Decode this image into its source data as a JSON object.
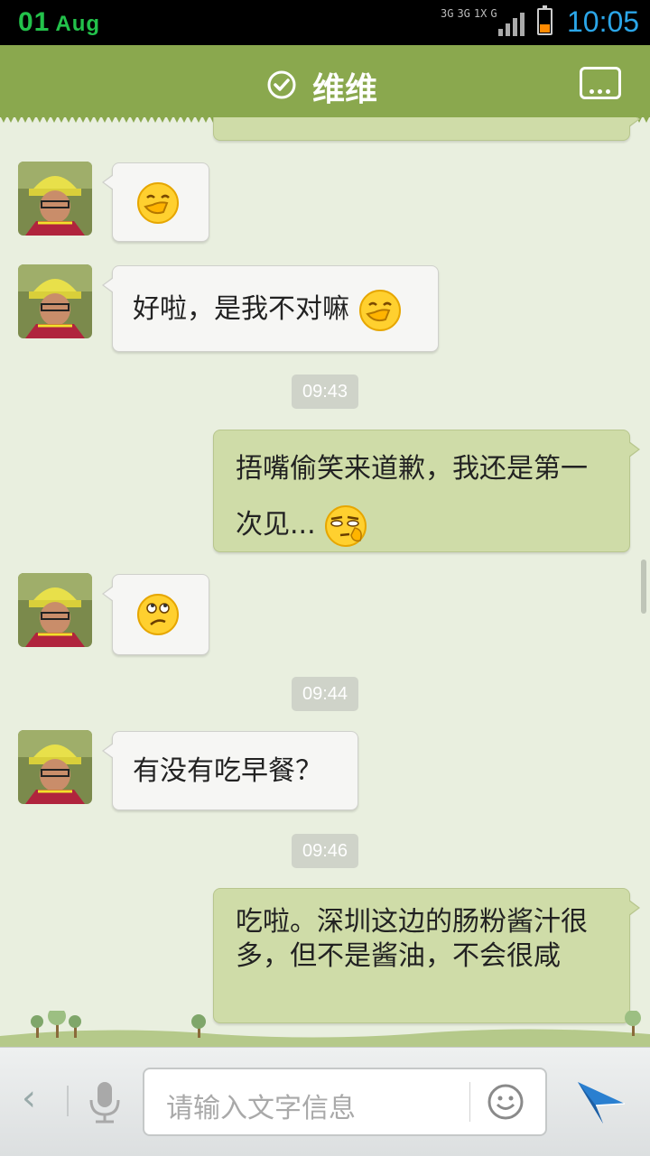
{
  "status_bar": {
    "date_day": "01",
    "date_month": "Aug",
    "network_labels": [
      "3G",
      "3G",
      "1X",
      "G"
    ],
    "time": "10:05"
  },
  "header": {
    "title": "维维",
    "verified_icon": "check-circle-icon",
    "menu_icon": "chat-menu-icon",
    "bg_color": "#8aa84e"
  },
  "messages": [
    {
      "side": "in",
      "text": "",
      "emoji": "giggle-emoji"
    },
    {
      "side": "in",
      "text": "好啦，是我不对嘛",
      "emoji": "giggle-emoji"
    },
    {
      "type": "time",
      "text": "09:43"
    },
    {
      "side": "out",
      "text": "捂嘴偷笑来道歉，我还是第一次见...",
      "emoji": "doubt-emoji"
    },
    {
      "side": "in",
      "text": "",
      "emoji": "confused-emoji"
    },
    {
      "type": "time",
      "text": "09:44"
    },
    {
      "side": "in",
      "text": "有没有吃早餐？"
    },
    {
      "type": "time",
      "text": "09:46"
    },
    {
      "side": "out",
      "text": "吃啦。深圳这边的肠粉酱汁很多，但不是酱油，不会很咸"
    }
  ],
  "input_bar": {
    "placeholder": "请输入文字信息",
    "back_icon": "chevron-left-icon",
    "mic_icon": "microphone-icon",
    "emoji_icon": "smiley-icon",
    "send_icon": "send-icon"
  },
  "colors": {
    "chat_bg": "#e9efdf",
    "outgoing_bubble": "#cfdca8",
    "incoming_bubble": "#f6f6f4",
    "time_accent": "#2ba6e8"
  }
}
